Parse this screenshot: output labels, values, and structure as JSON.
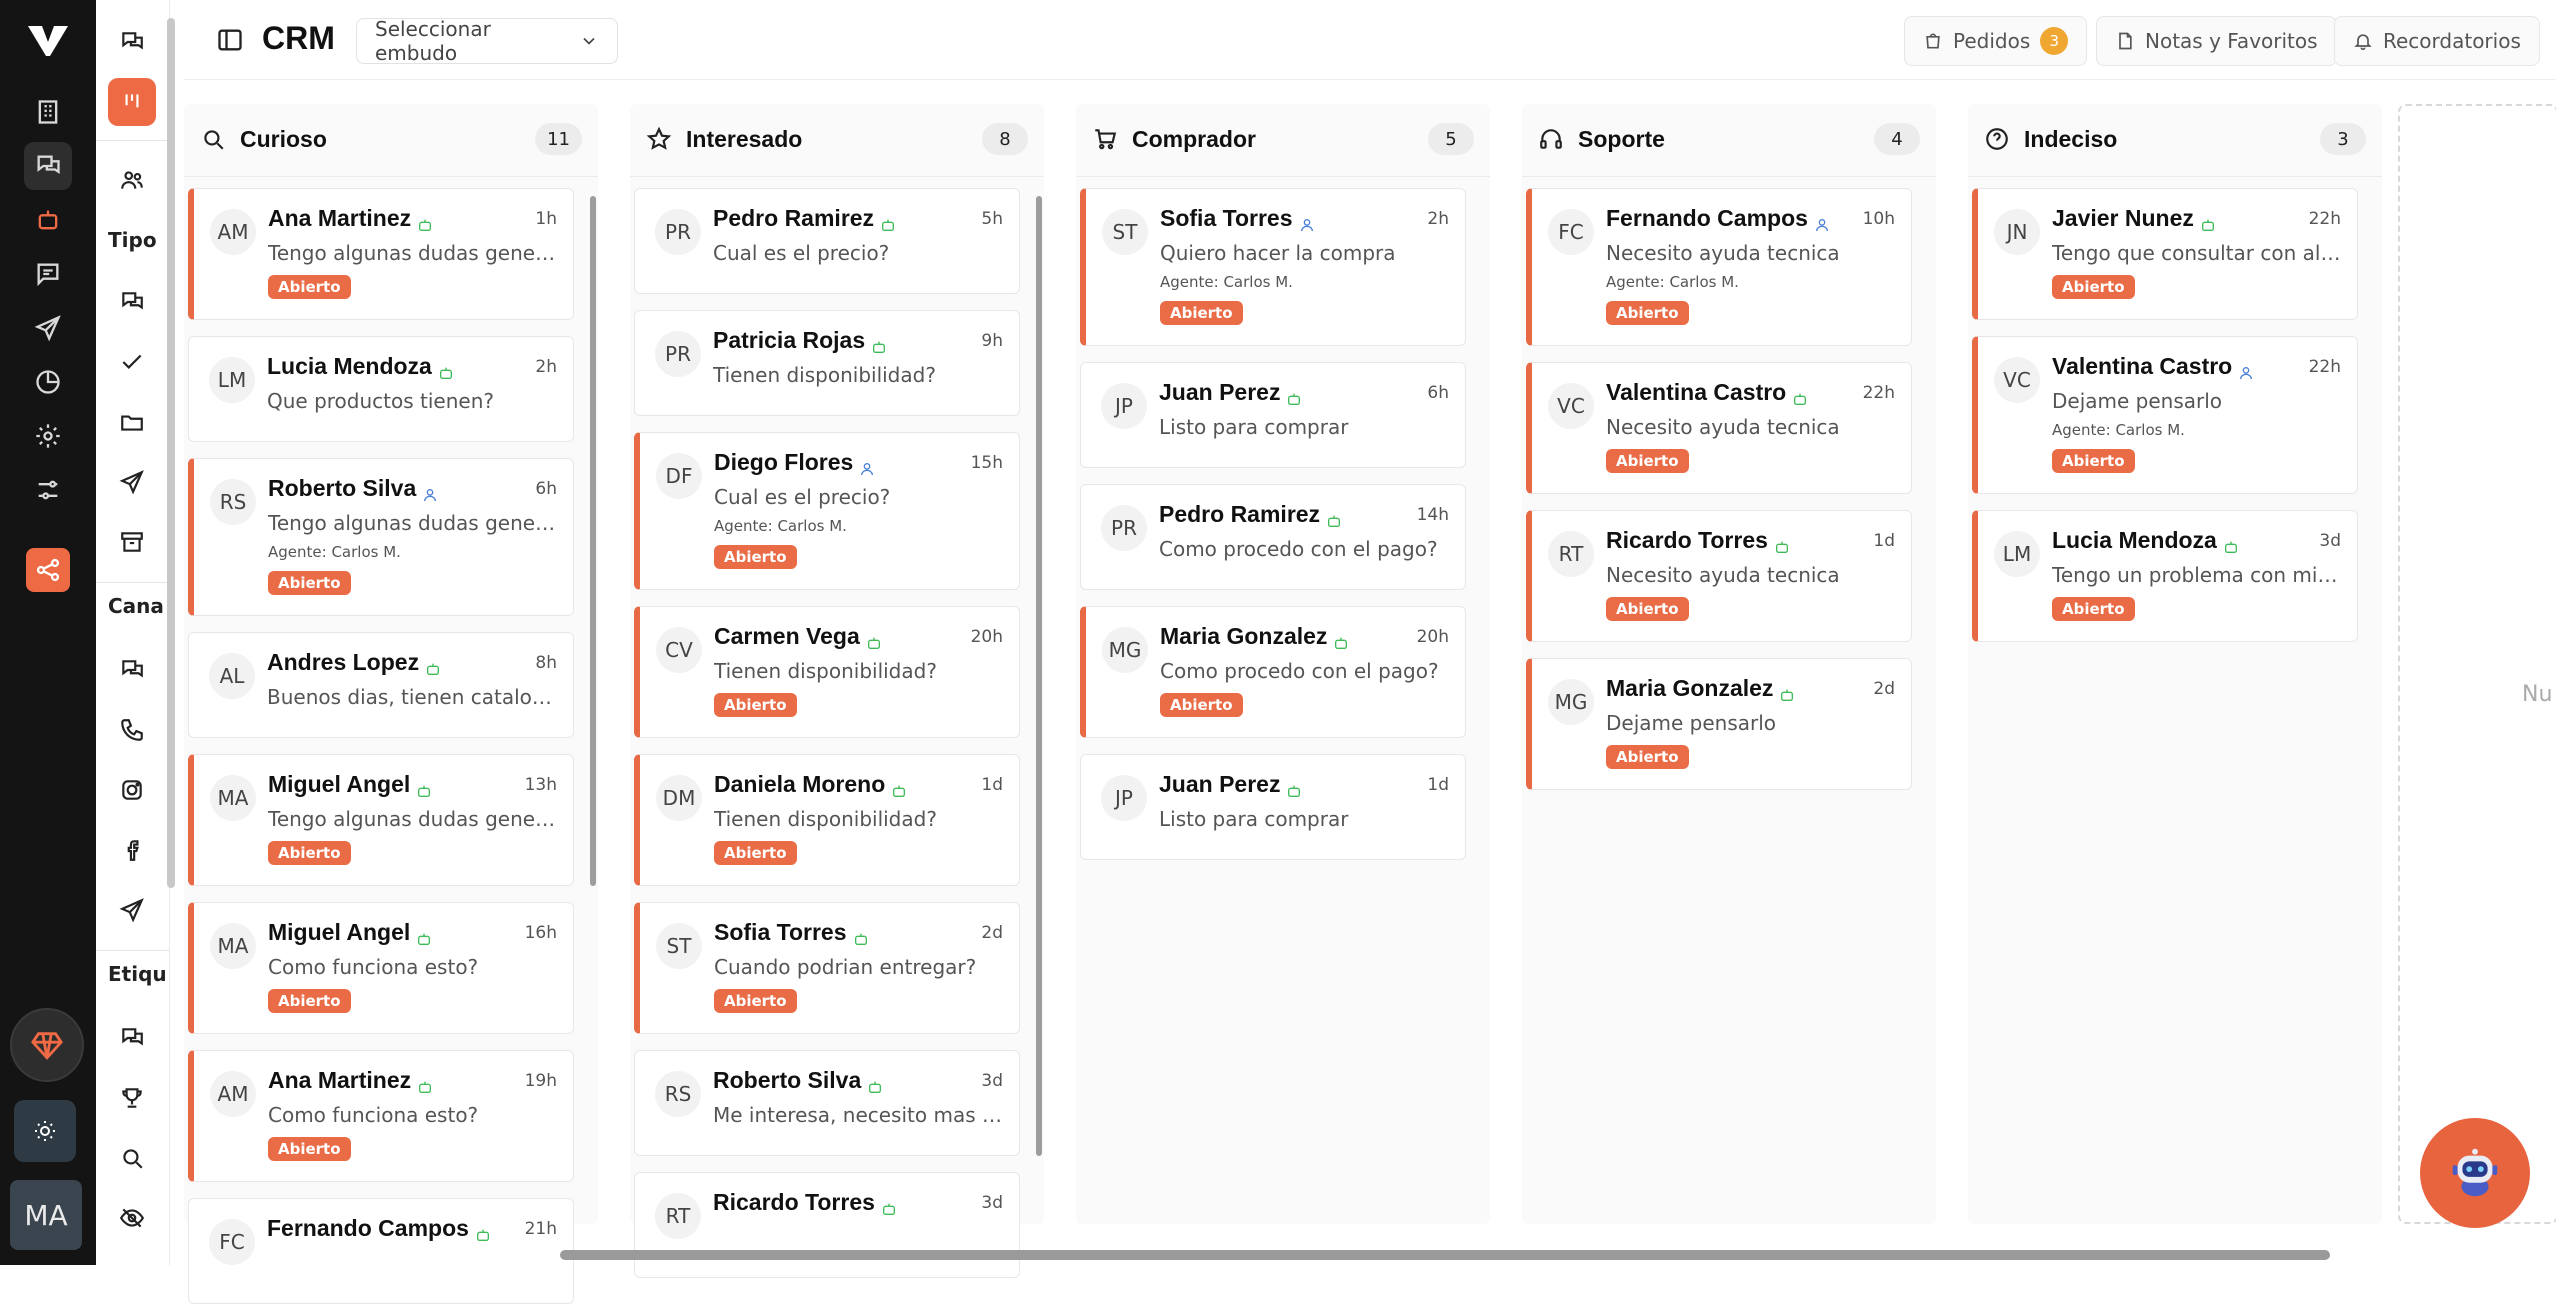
{
  "header": {
    "title": "CRM",
    "funnel_placeholder": "Seleccionar embudo",
    "orders_label": "Pedidos",
    "orders_count": "3",
    "notes_label": "Notas y Favoritos",
    "reminders_label": "Recordatorios"
  },
  "sidebar": {
    "section_tipo": "Tipo",
    "section_canales": "Cana",
    "section_etiquetas": "Etiqu",
    "user_initials": "MA"
  },
  "colors": {
    "accent": "#e96c47",
    "badge_orange": "#f0a732"
  },
  "columns": [
    {
      "name": "Curioso",
      "count": "11",
      "icon": "search-icon",
      "cards": [
        {
          "initials": "AM",
          "name": "Ana Martinez",
          "time": "1h",
          "msg": "Tengo algunas dudas general...",
          "agent": "",
          "badge": "Abierto",
          "tag": "bot"
        },
        {
          "initials": "LM",
          "name": "Lucia Mendoza",
          "time": "2h",
          "msg": "Que productos tienen?",
          "agent": "",
          "badge": "",
          "tag": "bot"
        },
        {
          "initials": "RS",
          "name": "Roberto Silva",
          "time": "6h",
          "msg": "Tengo algunas dudas general...",
          "agent": "Agente: Carlos M.",
          "badge": "Abierto",
          "tag": "user"
        },
        {
          "initials": "AL",
          "name": "Andres Lopez",
          "time": "8h",
          "msg": "Buenos dias, tienen catalogo?",
          "agent": "",
          "badge": "",
          "tag": "bot"
        },
        {
          "initials": "MA",
          "name": "Miguel Angel",
          "time": "13h",
          "msg": "Tengo algunas dudas general...",
          "agent": "",
          "badge": "Abierto",
          "tag": "bot"
        },
        {
          "initials": "MA",
          "name": "Miguel Angel",
          "time": "16h",
          "msg": "Como funciona esto?",
          "agent": "",
          "badge": "Abierto",
          "tag": "bot"
        },
        {
          "initials": "AM",
          "name": "Ana Martinez",
          "time": "19h",
          "msg": "Como funciona esto?",
          "agent": "",
          "badge": "Abierto",
          "tag": "bot"
        },
        {
          "initials": "FC",
          "name": "Fernando Campos",
          "time": "21h",
          "msg": "",
          "agent": "",
          "badge": "",
          "tag": "bot"
        }
      ]
    },
    {
      "name": "Interesado",
      "count": "8",
      "icon": "star-icon",
      "cards": [
        {
          "initials": "PR",
          "name": "Pedro Ramirez",
          "time": "5h",
          "msg": "Cual es el precio?",
          "agent": "",
          "badge": "",
          "tag": "bot"
        },
        {
          "initials": "PR",
          "name": "Patricia Rojas",
          "time": "9h",
          "msg": "Tienen disponibilidad?",
          "agent": "",
          "badge": "",
          "tag": "bot"
        },
        {
          "initials": "DF",
          "name": "Diego Flores",
          "time": "15h",
          "msg": "Cual es el precio?",
          "agent": "Agente: Carlos M.",
          "badge": "Abierto",
          "tag": "user"
        },
        {
          "initials": "CV",
          "name": "Carmen Vega",
          "time": "20h",
          "msg": "Tienen disponibilidad?",
          "agent": "",
          "badge": "Abierto",
          "tag": "bot"
        },
        {
          "initials": "DM",
          "name": "Daniela Moreno",
          "time": "1d",
          "msg": "Tienen disponibilidad?",
          "agent": "",
          "badge": "Abierto",
          "tag": "bot"
        },
        {
          "initials": "ST",
          "name": "Sofia Torres",
          "time": "2d",
          "msg": "Cuando podrian entregar?",
          "agent": "",
          "badge": "Abierto",
          "tag": "bot"
        },
        {
          "initials": "RS",
          "name": "Roberto Silva",
          "time": "3d",
          "msg": "Me interesa, necesito mas det...",
          "agent": "",
          "badge": "",
          "tag": "bot"
        },
        {
          "initials": "RT",
          "name": "Ricardo Torres",
          "time": "3d",
          "msg": "",
          "agent": "",
          "badge": "",
          "tag": "bot"
        }
      ]
    },
    {
      "name": "Comprador",
      "count": "5",
      "icon": "cart-icon",
      "cards": [
        {
          "initials": "ST",
          "name": "Sofia Torres",
          "time": "2h",
          "msg": "Quiero hacer la compra",
          "agent": "Agente: Carlos M.",
          "badge": "Abierto",
          "tag": "user"
        },
        {
          "initials": "JP",
          "name": "Juan Perez",
          "time": "6h",
          "msg": "Listo para comprar",
          "agent": "",
          "badge": "",
          "tag": "bot"
        },
        {
          "initials": "PR",
          "name": "Pedro Ramirez",
          "time": "14h",
          "msg": "Como procedo con el pago?",
          "agent": "",
          "badge": "",
          "tag": "bot"
        },
        {
          "initials": "MG",
          "name": "Maria Gonzalez",
          "time": "20h",
          "msg": "Como procedo con el pago?",
          "agent": "",
          "badge": "Abierto",
          "tag": "bot"
        },
        {
          "initials": "JP",
          "name": "Juan Perez",
          "time": "1d",
          "msg": "Listo para comprar",
          "agent": "",
          "badge": "",
          "tag": "bot"
        }
      ]
    },
    {
      "name": "Soporte",
      "count": "4",
      "icon": "headphones-icon",
      "cards": [
        {
          "initials": "FC",
          "name": "Fernando Campos",
          "time": "10h",
          "msg": "Necesito ayuda tecnica",
          "agent": "Agente: Carlos M.",
          "badge": "Abierto",
          "tag": "user"
        },
        {
          "initials": "VC",
          "name": "Valentina Castro",
          "time": "22h",
          "msg": "Necesito ayuda tecnica",
          "agent": "",
          "badge": "Abierto",
          "tag": "bot"
        },
        {
          "initials": "RT",
          "name": "Ricardo Torres",
          "time": "1d",
          "msg": "Necesito ayuda tecnica",
          "agent": "",
          "badge": "Abierto",
          "tag": "bot"
        },
        {
          "initials": "MG",
          "name": "Maria Gonzalez",
          "time": "2d",
          "msg": "Dejame pensarlo",
          "agent": "",
          "badge": "Abierto",
          "tag": "bot"
        }
      ]
    },
    {
      "name": "Indeciso",
      "count": "3",
      "icon": "question-icon",
      "cards": [
        {
          "initials": "JN",
          "name": "Javier Nunez",
          "time": "22h",
          "msg": "Tengo que consultar con algui...",
          "agent": "",
          "badge": "Abierto",
          "tag": "bot"
        },
        {
          "initials": "VC",
          "name": "Valentina Castro",
          "time": "22h",
          "msg": "Dejame pensarlo",
          "agent": "Agente: Carlos M.",
          "badge": "Abierto",
          "tag": "user"
        },
        {
          "initials": "LM",
          "name": "Lucia Mendoza",
          "time": "3d",
          "msg": "Tengo un problema con mi pe...",
          "agent": "",
          "badge": "Abierto",
          "tag": "bot"
        }
      ]
    }
  ],
  "new_column_label": "Nu"
}
